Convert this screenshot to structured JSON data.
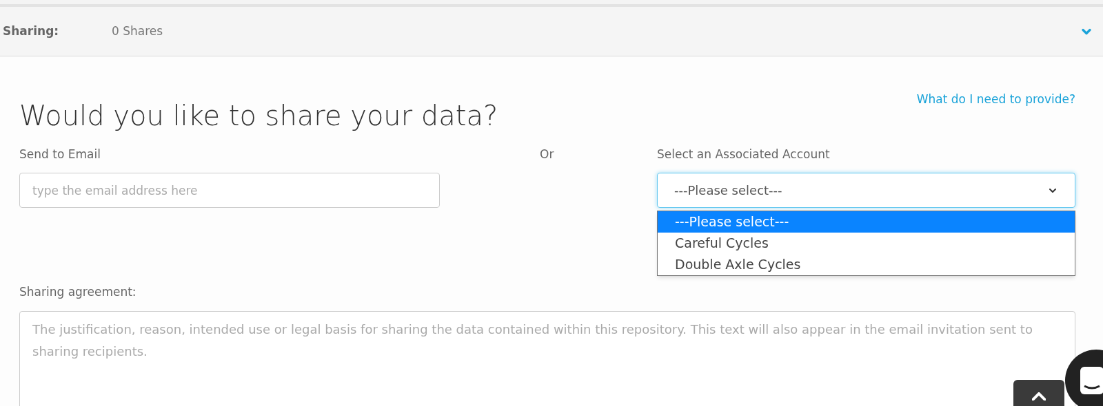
{
  "sharing_bar": {
    "label": "Sharing:",
    "count": "0 Shares",
    "expanded": true
  },
  "heading": "Would you like to share your data?",
  "help_link": "What do I need to provide?",
  "email": {
    "label": "Send to Email",
    "placeholder": "type the email address here"
  },
  "or_text": "Or",
  "account_select": {
    "label": "Select an Associated Account",
    "value": "---Please select---",
    "open": true,
    "options": [
      {
        "label": "---Please select---",
        "selected": true
      },
      {
        "label": "Careful Cycles",
        "selected": false
      },
      {
        "label": "Double Axle Cycles",
        "selected": false
      }
    ]
  },
  "agreement": {
    "label": "Sharing agreement:",
    "placeholder": "The justification, reason, intended use or legal basis for sharing the data contained within this repository. This text will also appear in the email invitation sent to sharing recipients."
  }
}
